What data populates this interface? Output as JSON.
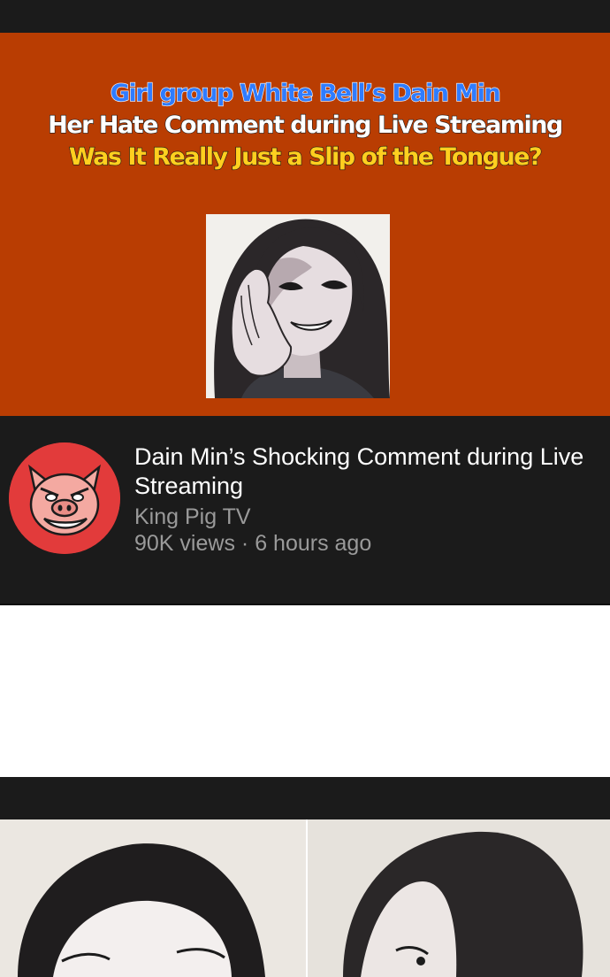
{
  "thumbnail": {
    "headline_line1": "Girl group White Bell’s Dain Min",
    "headline_line2": "Her Hate Comment during  Live Streaming",
    "headline_line3": "Was It Really Just a Slip of the Tongue?",
    "background_color": "#b93d02",
    "line1_color": "#2f7cff",
    "line3_color": "#ffcf1f"
  },
  "video": {
    "title": "Dain Min’s Shocking Comment during Live Streaming",
    "channel": "King Pig TV",
    "views": "90K views",
    "separator": "·",
    "time_ago": "6 hours ago",
    "avatar_icon": "pig-face-icon",
    "avatar_color": "#e23b3b"
  }
}
